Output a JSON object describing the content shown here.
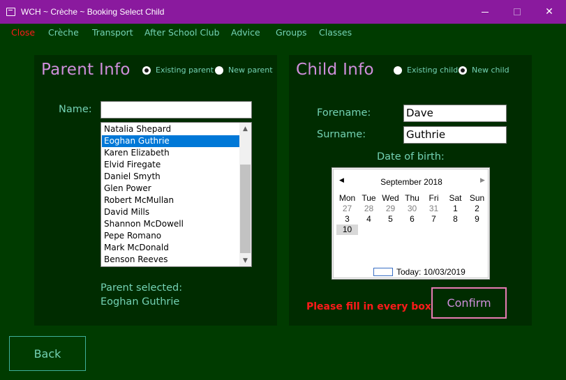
{
  "window": {
    "title": "WCH ~ Crèche ~ Booking Select Child",
    "minimize_symbol": "",
    "maximize_symbol": "",
    "close_symbol": "✕"
  },
  "menu": [
    "Close",
    "Crèche",
    "Transport",
    "After School Club",
    "Advice",
    "Groups",
    "Classes"
  ],
  "parent": {
    "title": "Parent Info",
    "radio_existing": "Existing parent",
    "radio_new": "New parent",
    "existing_checked": true,
    "name_label": "Name:",
    "name_value": "",
    "list": [
      "Natalia Shepard",
      "Eoghan Guthrie",
      "Karen Elizabeth",
      "Elvid Firegate",
      "Daniel Smyth",
      "Glen Power",
      "Robert McMullan",
      "David Mills",
      "Shannon McDowell",
      "Pepe Romano",
      "Mark McDonald",
      "Benson Reeves"
    ],
    "selected_index": 1,
    "selected_label": "Parent selected:",
    "selected_value": "Eoghan Guthrie"
  },
  "child": {
    "title": "Child Info",
    "radio_existing": "Existing child",
    "radio_new": "New child",
    "new_checked": true,
    "forename_label": "Forename:",
    "forename_value": "Dave",
    "surname_label": "Surname:",
    "surname_value": "Guthrie",
    "dob_label": "Date of birth:"
  },
  "calendar": {
    "month_label": "September 2018",
    "prev_symbol": "◀",
    "next_symbol": "▶",
    "days_of_week": [
      "Mon",
      "Tue",
      "Wed",
      "Thu",
      "Fri",
      "Sat",
      "Sun"
    ],
    "weeks": [
      [
        {
          "d": "27",
          "other": true
        },
        {
          "d": "28",
          "other": true
        },
        {
          "d": "29",
          "other": true
        },
        {
          "d": "30",
          "other": true
        },
        {
          "d": "31",
          "other": true
        },
        {
          "d": "1"
        },
        {
          "d": "2"
        }
      ],
      [
        {
          "d": "3"
        },
        {
          "d": "4"
        },
        {
          "d": "5"
        },
        {
          "d": "6"
        },
        {
          "d": "7"
        },
        {
          "d": "8"
        },
        {
          "d": "9"
        }
      ],
      [
        {
          "d": "10",
          "selected": true
        }
      ]
    ],
    "today_text": "Today: 10/03/2019"
  },
  "status": {
    "error": "Please fill in every box"
  },
  "buttons": {
    "confirm": "Confirm",
    "back": "Back"
  },
  "scroll": {
    "up_symbol": "▲",
    "down_symbol": "▼"
  },
  "colors": {
    "titlebar": "#8a1a9e",
    "background": "#003b00",
    "panel": "#002c00",
    "accent_text": "#74d2b4",
    "title_text": "#d08fdc",
    "error": "#ff1a1a",
    "selection": "#0078d7"
  }
}
